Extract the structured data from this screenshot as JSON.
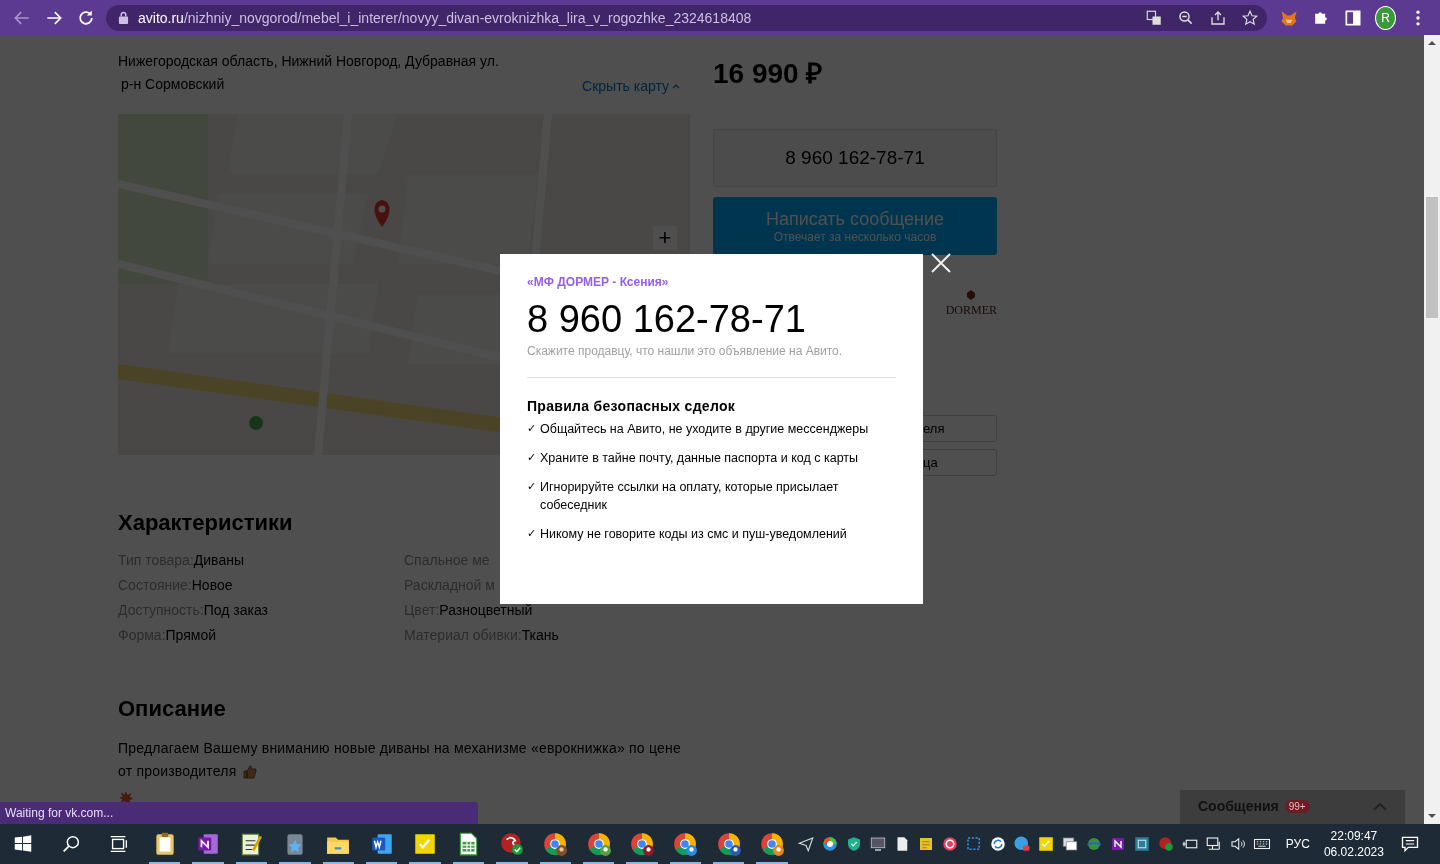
{
  "browser": {
    "url": {
      "host": "avito.ru",
      "path": "/nizhniy_novgorod/mebel_i_interer/novyy_divan-evroknizhka_lira_v_rogozhke_2324618408"
    },
    "profile_initial": "R"
  },
  "listing": {
    "address": "Нижегородская область, Нижний Новгород, Дубравная ул.",
    "district": "р-н Сормовский",
    "hide_map": "Скрыть карту",
    "map": {
      "zoom_in": "+"
    },
    "price": "16 990 ₽",
    "phone_button": "8 960 162-78-71",
    "message_button": {
      "label": "Написать сообщение",
      "note": "Отвечает за несколько часов"
    },
    "seller_logo": "DORMER",
    "side_buttons": [
      "еля",
      "ца"
    ],
    "specs_title": "Характеристики",
    "specs_left": [
      {
        "label": "Тип товара:",
        "value": "Диваны"
      },
      {
        "label": "Состояние:",
        "value": "Новое"
      },
      {
        "label": "Доступность:",
        "value": "Под заказ"
      },
      {
        "label": "Форма:",
        "value": "Прямой"
      }
    ],
    "specs_right": [
      {
        "label": "Спальное ме"
      },
      {
        "label": "Раскладной м"
      },
      {
        "label": "Цвет:",
        "value": "Разноцветный"
      },
      {
        "label": "Материал обивки:",
        "value": "Ткань"
      }
    ],
    "description_title": "Описание",
    "description_lines": [
      "Предлагаем Вашему вниманию новые диваны на механизме «еврокнижка» по цене",
      "от производителя"
    ],
    "messages": {
      "label": "Сообщения",
      "badge": "99+"
    }
  },
  "modal": {
    "seller": "«МФ ДОРМЕР - Ксения»",
    "phone": "8 960 162-78-71",
    "hint": "Скажите продавцу, что нашли это объявление на Авито.",
    "rules_title": "Правила безопасных сделок",
    "rules": [
      {
        "mark": "✓",
        "text": "Общайтесь на Авито, не уходите в другие мессенджеры"
      },
      {
        "mark": "✓",
        "text": "Храните в тайне почту, данные паспорта и код с карты"
      },
      {
        "mark": "✓",
        "text": "Игнорируйте ссылки на оплату, которые присылает собеседник"
      },
      {
        "mark": "✓",
        "text": "Никому не говорите коды из смс и пуш-уведомлений"
      }
    ]
  },
  "status_bubble": "Waiting for vk.com...",
  "taskbar": {
    "apps": [
      {
        "running": true
      },
      {
        "running": true
      },
      {
        "running": true
      },
      {
        "running": true
      },
      {
        "running": true
      },
      {
        "running": true
      },
      {
        "running": true
      },
      {
        "running": true
      },
      {
        "running": true
      },
      {
        "running": true
      },
      {
        "running": true
      },
      {
        "running": true
      },
      {
        "running": true
      },
      {
        "running": true
      },
      {
        "running": true
      }
    ],
    "language": "РУС",
    "time": "22:09:47",
    "date": "06.02.2023"
  }
}
